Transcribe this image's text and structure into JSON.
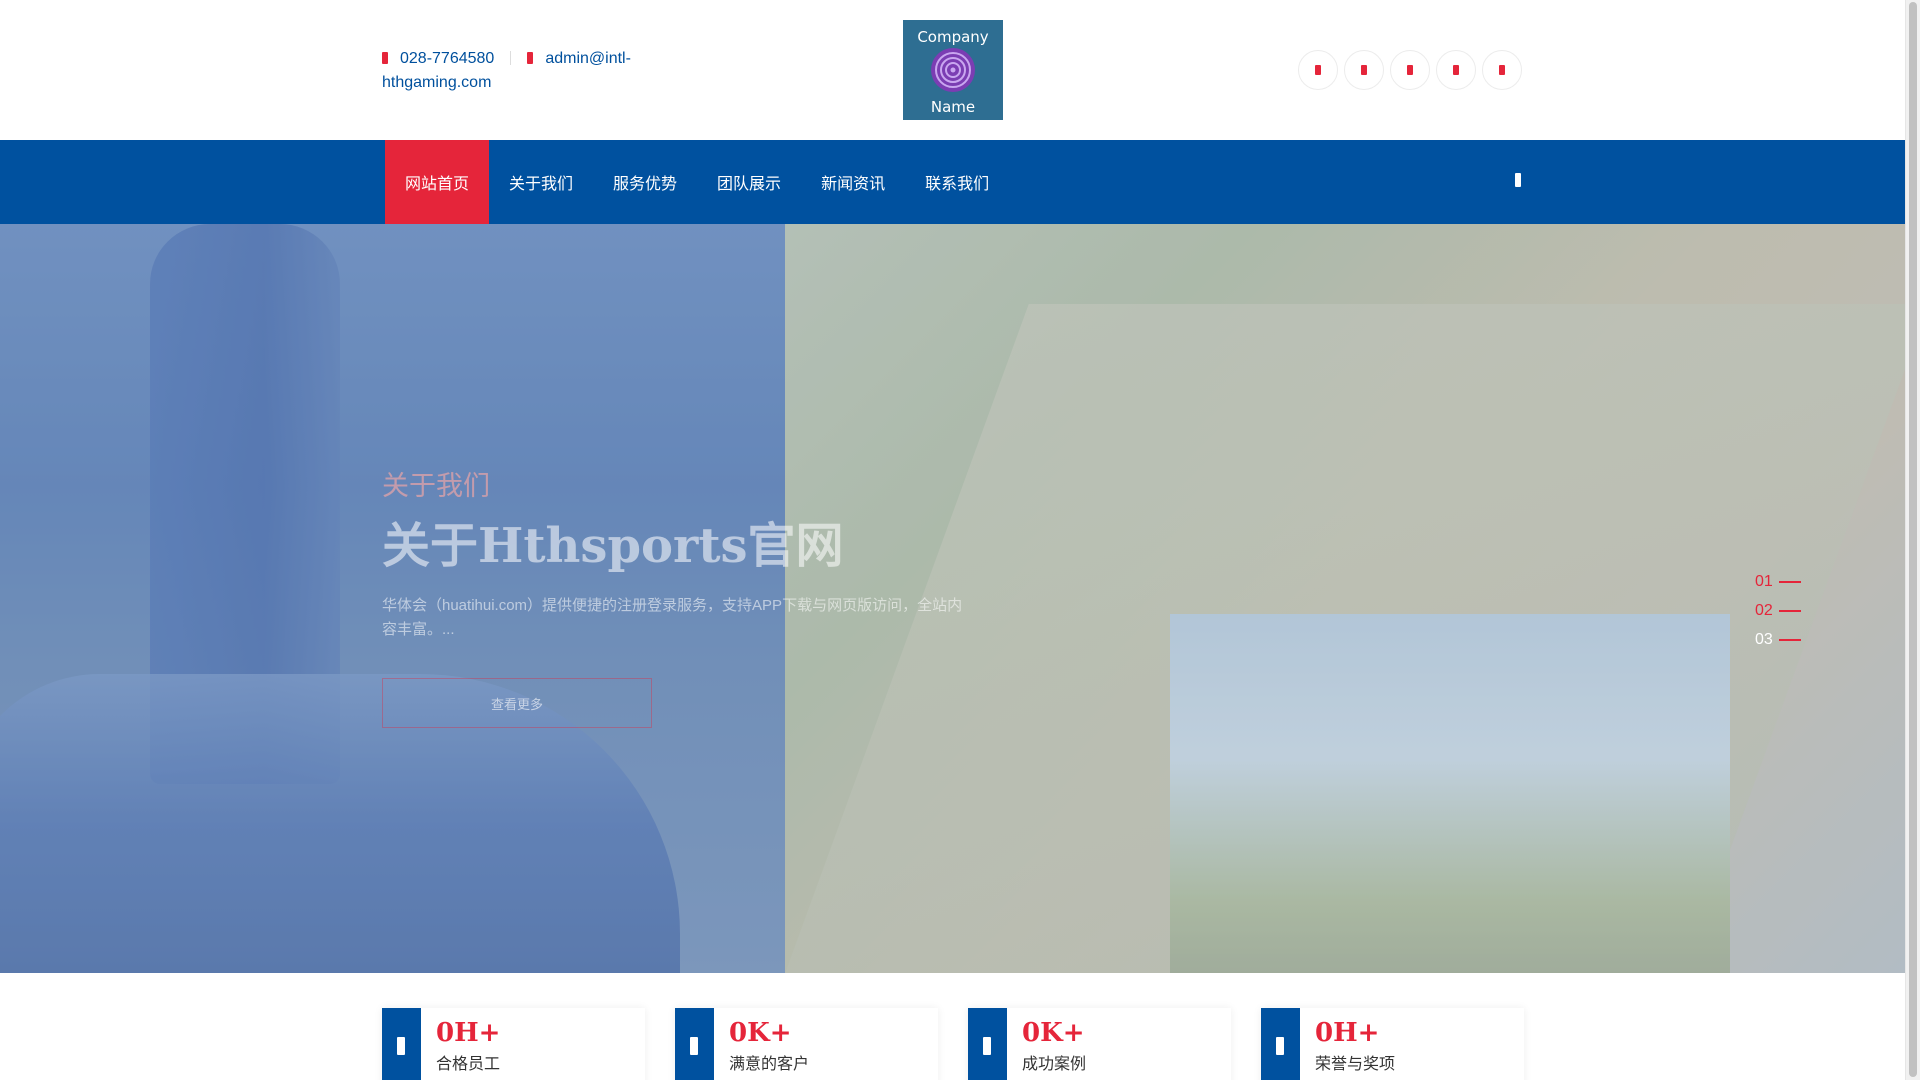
{
  "header": {
    "phone": "028-7764580",
    "email": "admin@intl-hthgaming.com",
    "logo_text_top": "Company",
    "logo_text_bottom": "Name",
    "social_icons": [
      "social-icon-1",
      "social-icon-2",
      "social-icon-3",
      "social-icon-4",
      "social-icon-5"
    ]
  },
  "nav": {
    "items": [
      "网站首页",
      "关于我们",
      "服务优势",
      "团队展示",
      "新闻资讯",
      "联系我们"
    ],
    "active_index": 0
  },
  "hero": {
    "kicker": "关于我们",
    "title": "关于Hthsports官网",
    "description": "华体会（huatihui.com）提供便捷的注册登录服务，支持APP下载与网页版访问，全站内容丰富。...",
    "button": "查看更多",
    "pager": [
      "01",
      "02",
      "03"
    ],
    "current_slide": 2
  },
  "stats": [
    {
      "number": "0H+",
      "label": "合格员工"
    },
    {
      "number": "0K+",
      "label": "满意的客户"
    },
    {
      "number": "0K+",
      "label": "成功案例"
    },
    {
      "number": "0H+",
      "label": "荣誉与奖项"
    }
  ],
  "colors": {
    "primary": "#00519f",
    "accent": "#e5253a"
  }
}
